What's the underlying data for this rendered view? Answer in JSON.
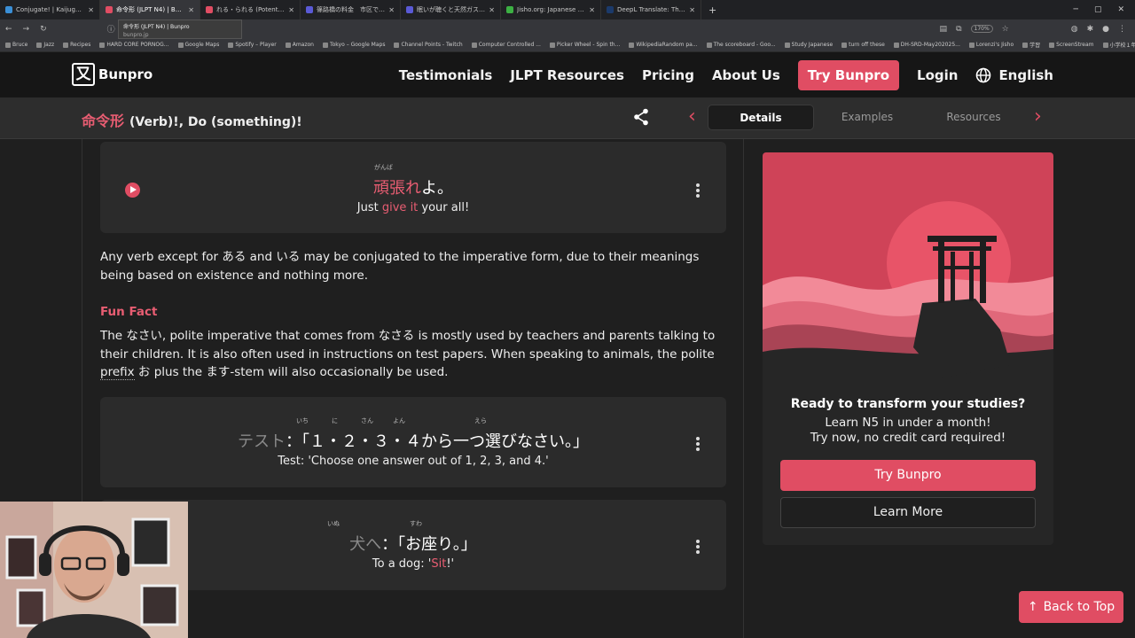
{
  "browser": {
    "tabs": [
      {
        "title": "Conjugate! | Kaijugation - Bunp",
        "color": "#3a8fd6",
        "active": false
      },
      {
        "title": "命令形 (JLPT N4) | Bunpro",
        "color": "#e04d63",
        "active": true
      },
      {
        "title": "れる・られる (Potential) (JLPT",
        "color": "#e04d63",
        "active": false
      },
      {
        "title": "篠路橋の料金　市区でない人に",
        "color": "#5a5ad6",
        "active": false
      },
      {
        "title": "眠いが聴くと天然ガスの価格が",
        "color": "#5a5ad6",
        "active": false
      },
      {
        "title": "Jisho.org: Japanese Dictionary",
        "color": "#3cb043",
        "active": false
      },
      {
        "title": "DeepL Translate: The world's m",
        "color": "#1b3a6b",
        "active": false
      }
    ],
    "new_tab": "+",
    "tooltip": {
      "title": "命令形 (JLPT N4) | Bunpro",
      "domain": "bunpro.jp"
    },
    "zoom": "170%",
    "bookmarks": [
      "Bruce",
      "Jazz",
      "Recipes",
      "HARD CORE PORNOG...",
      "Google Maps",
      "Spotify – Player",
      "Amazon",
      "Tokyo – Google Maps",
      "Channel Points - Twitch",
      "Computer Controlled ...",
      "Picker Wheel - Spin th...",
      "WikipediaRandom pa...",
      "The scoreboard - Goo...",
      "Study Japanese",
      "turn off these",
      "DH-SRD-May202025...",
      "Lorenzi's Jisho",
      "学習",
      "ScreenStream",
      "小学校１年生漢字の..."
    ]
  },
  "site": {
    "logo_mark": "又",
    "brand": "Bunpro",
    "nav": [
      "Testimonials",
      "JLPT Resources",
      "Pricing",
      "About Us"
    ],
    "try_label": "Try Bunpro",
    "login_label": "Login",
    "language_label": "English"
  },
  "grammar": {
    "title": "命令形",
    "meaning": "(Verb)!, Do (something)!",
    "tabs": [
      "Details",
      "Examples",
      "Resources"
    ],
    "active_tab": "Details"
  },
  "examples": [
    {
      "ruby": "がんば",
      "jp_highlight": "頑張れ",
      "jp_rest": "よ。",
      "en_pre": "Just ",
      "en_highlight": "give it",
      "en_post": " your all!"
    },
    {
      "prefix": "テスト",
      "jp": "：「１・２・３・４から一つ選びなさい。」",
      "ruby": [
        "いち",
        "に",
        "さん",
        "よん",
        "えら"
      ],
      "en": "Test: 'Choose one answer out of 1, 2, 3, and 4.'"
    },
    {
      "prefix": "犬へ",
      "jp": "：「お座り。」",
      "ruby": [
        "いぬ",
        "すわ"
      ],
      "en_pre": "To a dog: '",
      "en_highlight": "Sit",
      "en_post": "!'"
    }
  ],
  "body": {
    "paragraph": "Any verb except for ある and いる may be conjugated to the imperative form, due to their meanings being based on existence and nothing more.",
    "fun_fact_heading": "Fun Fact",
    "fun_fact_pre": "The なさい, polite imperative that comes from なさる is mostly used by teachers and parents talking to their children. It is also often used in instructions on test papers. When speaking to animals, the polite ",
    "fun_fact_link": "prefix",
    "fun_fact_post": " お plus the ます-stem will also occasionally be used."
  },
  "promo": {
    "heading": "Ready to transform your studies?",
    "line1": "Learn N5 in under a month!",
    "line2": "Try now, no credit card required!",
    "try_label": "Try Bunpro",
    "learn_label": "Learn More"
  },
  "back_to_top": "Back to Top",
  "colors": {
    "accent": "#e04d63",
    "header_bg": "#161616",
    "page_bg": "#1f1f1f",
    "card_bg": "#2b2b2b"
  }
}
